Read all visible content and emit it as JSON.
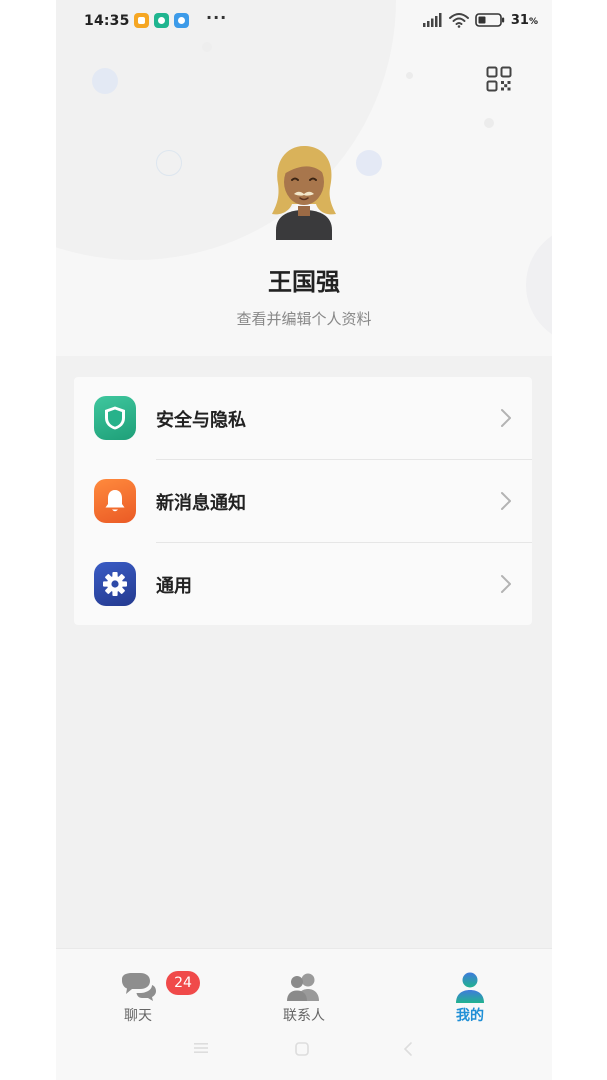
{
  "status_bar": {
    "time": "14:35",
    "overflow": "···",
    "battery": "31",
    "battery_unit": "%",
    "app_icon_colors": [
      "#f5a623",
      "#1fb58f",
      "#3d9be9"
    ]
  },
  "header": {
    "qr_icon": "qr-code-icon",
    "user_name": "王国强",
    "edit_profile": "查看并编辑个人资料"
  },
  "menu": [
    {
      "label": "安全与隐私",
      "icon": "shield-icon",
      "color": "#27b28a"
    },
    {
      "label": "新消息通知",
      "icon": "bell-icon",
      "color": "#f06a30"
    },
    {
      "label": "通用",
      "icon": "gear-icon",
      "color": "#2e4aa8"
    }
  ],
  "bottom_nav": {
    "tabs": [
      {
        "label": "聊天",
        "icon": "chat-icon",
        "badge": "24"
      },
      {
        "label": "联系人",
        "icon": "contacts-icon"
      },
      {
        "label": "我的",
        "icon": "me-icon",
        "active": true
      }
    ],
    "active_color": "#1f8fd6",
    "badge_color": "#f04a4a"
  }
}
